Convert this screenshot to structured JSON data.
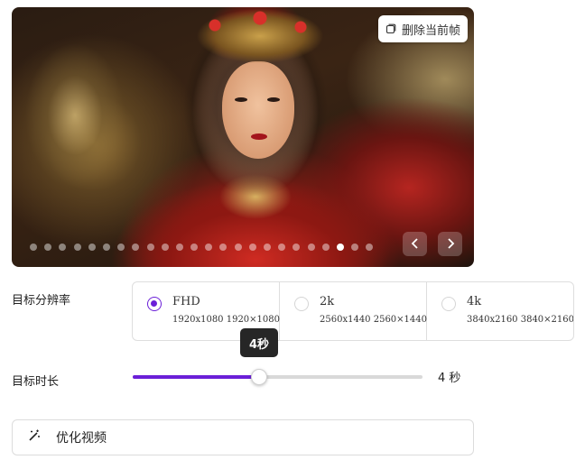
{
  "preview": {
    "delete_frame_label": "删除当前帧",
    "frame_count": 24,
    "active_frame_index": 21
  },
  "resolution": {
    "label": "目标分辨率",
    "options": [
      {
        "name": "FHD",
        "dims": "1920x1080 1920×1080",
        "selected": true
      },
      {
        "name": "2k",
        "dims": "2560x1440 2560×1440",
        "selected": false
      },
      {
        "name": "4k",
        "dims": "3840x2160 3840×2160",
        "selected": false
      }
    ]
  },
  "duration": {
    "label": "目标时长",
    "tooltip": "4秒",
    "value_text": "4 秒",
    "fraction": 0.435
  },
  "optimize": {
    "label": "优化视频"
  },
  "colors": {
    "accent": "#6b1fd8"
  },
  "icons": {
    "delete": "copy-frame-icon",
    "prev": "chevron-left-icon",
    "next": "chevron-right-icon",
    "optimize": "magic-wand-icon"
  }
}
